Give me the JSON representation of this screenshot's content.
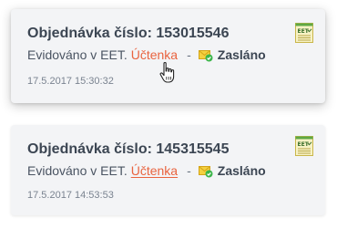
{
  "orders": [
    {
      "title": "Objednávka číslo: 153015546",
      "eet_text": "Evidováno v EET.",
      "receipt_link": "Účtenka",
      "separator": "-",
      "status": "Zasláno",
      "timestamp": "17.5.2017 15:30:32",
      "badge_icon": "eet-receipt-icon",
      "status_icon": "envelope-check-icon"
    },
    {
      "title": "Objednávka číslo: 145315545",
      "eet_text": "Evidováno v EET.",
      "receipt_link": "Účtenka",
      "separator": "-",
      "status": "Zasláno",
      "timestamp": "17.5.2017 14:53:53",
      "badge_icon": "eet-receipt-icon",
      "status_icon": "envelope-check-icon"
    }
  ],
  "colors": {
    "card_bg": "#f3f4f6",
    "title": "#3c4653",
    "link": "#e9633f",
    "muted": "#7a8390",
    "check": "#3bb54a"
  }
}
